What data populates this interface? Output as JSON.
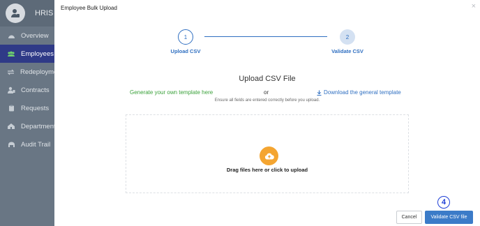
{
  "sidebar": {
    "app_name": "HRIS",
    "items": [
      {
        "label": "Overview",
        "icon": "dashboard-icon",
        "active": false
      },
      {
        "label": "Employees",
        "icon": "users-icon",
        "active": true
      },
      {
        "label": "Redeployme",
        "icon": "swap-icon",
        "active": false
      },
      {
        "label": "Contracts",
        "icon": "user-contract-icon",
        "active": false
      },
      {
        "label": "Requests",
        "icon": "clipboard-icon",
        "active": false
      },
      {
        "label": "Department",
        "icon": "building-icon",
        "active": false
      },
      {
        "label": "Audit Trail",
        "icon": "audit-icon",
        "active": false
      }
    ]
  },
  "modal": {
    "title": "Employee Bulk Upload",
    "close_label": "×",
    "steps": [
      {
        "number": "1",
        "label": "Upload CSV",
        "state": "current"
      },
      {
        "number": "2",
        "label": "Validate CSV",
        "state": "pending"
      }
    ],
    "heading": "Upload CSV File",
    "generate_link": "Generate your own template here",
    "or_text": "or",
    "download_link": "Download the general template",
    "hint": "Ensure all fields are entered correctly before you upload.",
    "dropzone_text": "Drag files here or click to upload",
    "cancel_label": "Cancel",
    "validate_label": "Validate CSV file",
    "callout_number": "4"
  },
  "colors": {
    "accent": "#2f6fc1",
    "primary_button": "#3b7bc8",
    "success_link": "#3aa13a",
    "upload_icon": "#f4a531",
    "sidebar_active": "#2f3a87"
  }
}
